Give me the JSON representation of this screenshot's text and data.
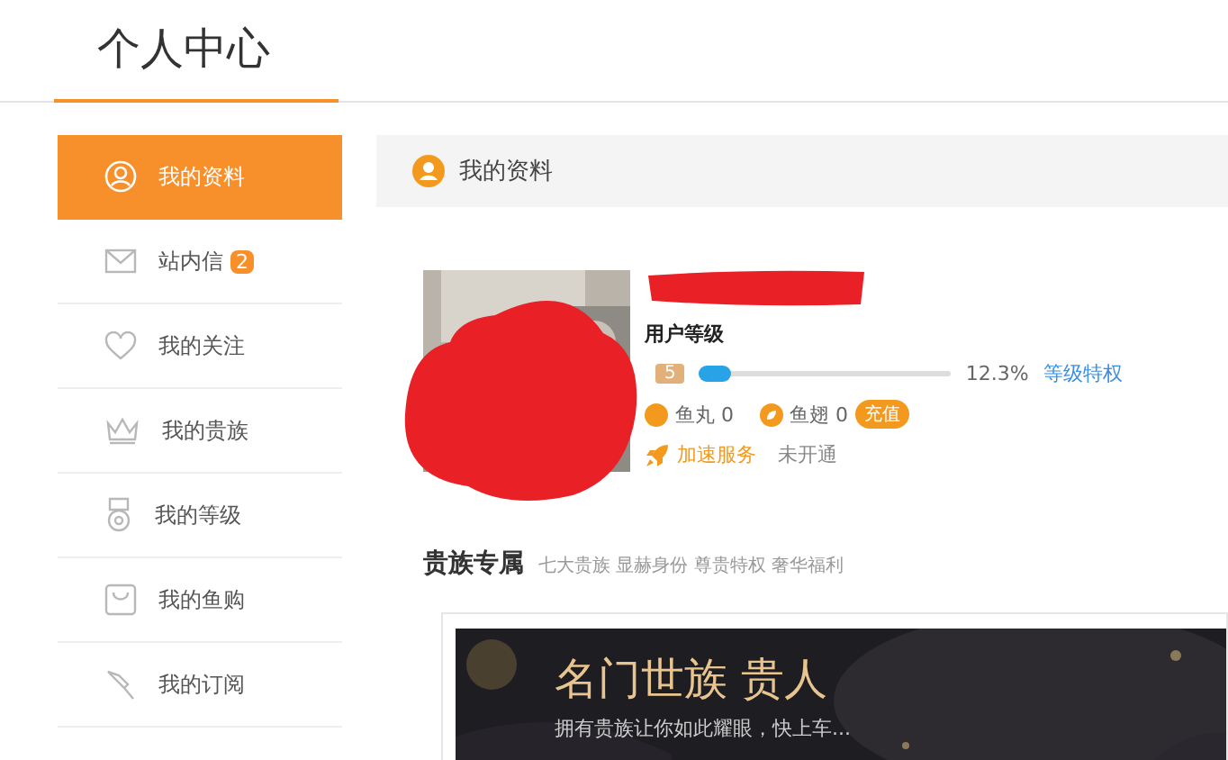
{
  "page_title": "个人中心",
  "sidebar": {
    "items": [
      {
        "label": "我的资料",
        "selected": true
      },
      {
        "label": "站内信",
        "selected": false,
        "badge": "2"
      },
      {
        "label": "我的关注",
        "selected": false
      },
      {
        "label": "我的贵族",
        "selected": false
      },
      {
        "label": "我的等级",
        "selected": false
      },
      {
        "label": "我的鱼购",
        "selected": false
      },
      {
        "label": "我的订阅",
        "selected": false
      }
    ]
  },
  "profile": {
    "header": "我的资料",
    "level_label": "用户等级",
    "level_badge": "5",
    "progress": {
      "level": 0.123,
      "reading": "12.3%"
    },
    "level_link": "等级特权",
    "currencies": [
      {
        "label": "鱼丸 0"
      },
      {
        "label": "鱼翅 0"
      }
    ],
    "recharge_button": "充值",
    "service": {
      "label": "加速服务",
      "status": "未开通"
    }
  },
  "noble": {
    "title": "贵族专属",
    "subtitle": "七大贵族 显赫身份 尊贵特权 奢华福利",
    "banner": {
      "headline": "名门世族 贵人",
      "text": "拥有贵族让你如此耀眼，快上车..."
    }
  }
}
